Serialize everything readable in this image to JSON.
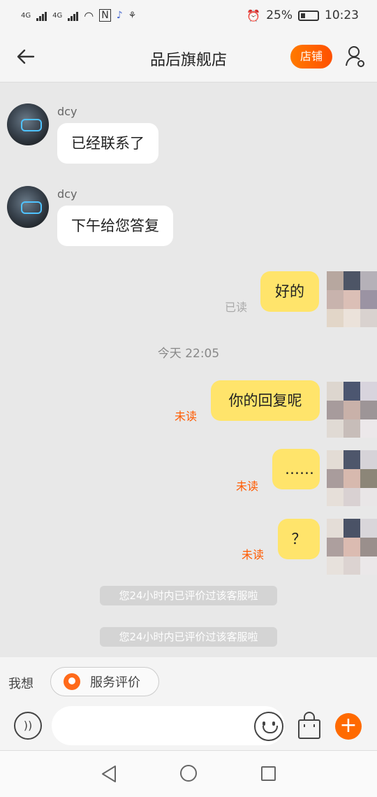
{
  "status_bar": {
    "network_1": "4G",
    "network_2": "4G",
    "battery": "25%",
    "time": "10:23"
  },
  "header": {
    "title": "品后旗舰店",
    "store_button": "店铺"
  },
  "messages": [
    {
      "sender": "dcy",
      "text": "已经联系了"
    },
    {
      "sender": "dcy",
      "text": "下午给您答复"
    },
    {
      "text": "好的",
      "status": "已读"
    },
    {
      "text": "你的回复呢",
      "status": "未读"
    },
    {
      "text": "……",
      "status": "未读"
    },
    {
      "text": "？",
      "status": "未读"
    }
  ],
  "time_divider": "今天  22:05",
  "system_messages": [
    "您24小时内已评价过该客服啦",
    "您24小时内已评价过该客服啦"
  ],
  "quick": {
    "label": "我想",
    "chip": "服务评价"
  },
  "colors": {
    "accent": "#ff6a00",
    "outgoing_bubble": "#ffe46b",
    "unread": "#ff5a00"
  }
}
